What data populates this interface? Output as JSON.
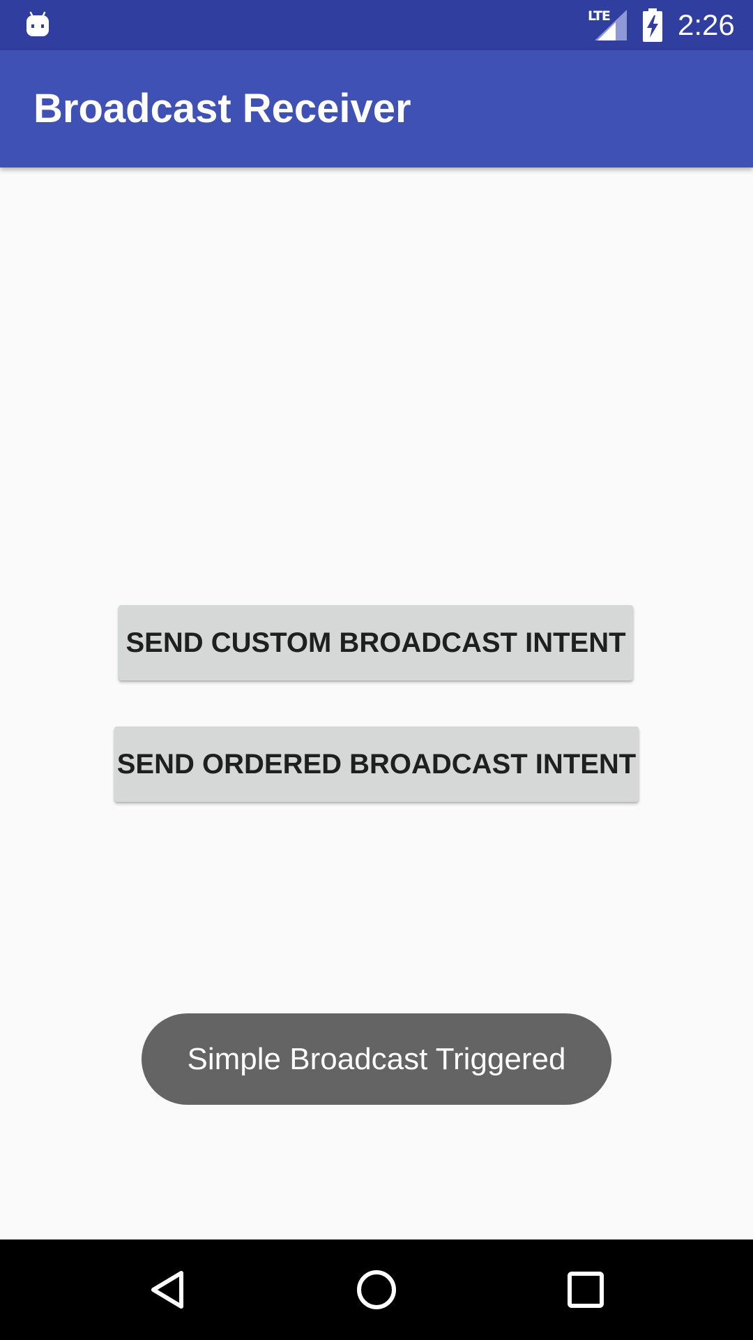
{
  "status_bar": {
    "notification_icon": "android-icon",
    "network_label": "LTE",
    "signal_icon": "cell-signal-icon",
    "battery_icon": "battery-charging-icon",
    "time": "2:26",
    "background": "#303f9f"
  },
  "app_bar": {
    "title": "Broadcast Receiver",
    "background": "#3f51b5"
  },
  "main": {
    "buttons": [
      {
        "label": "SEND CUSTOM BROADCAST INTENT"
      },
      {
        "label": "SEND ORDERED BROADCAST INTENT"
      }
    ]
  },
  "toast": {
    "message": "Simple Broadcast Triggered"
  },
  "nav_bar": {
    "back_icon": "back-triangle-icon",
    "home_icon": "home-circle-icon",
    "recents_icon": "recents-square-icon"
  }
}
